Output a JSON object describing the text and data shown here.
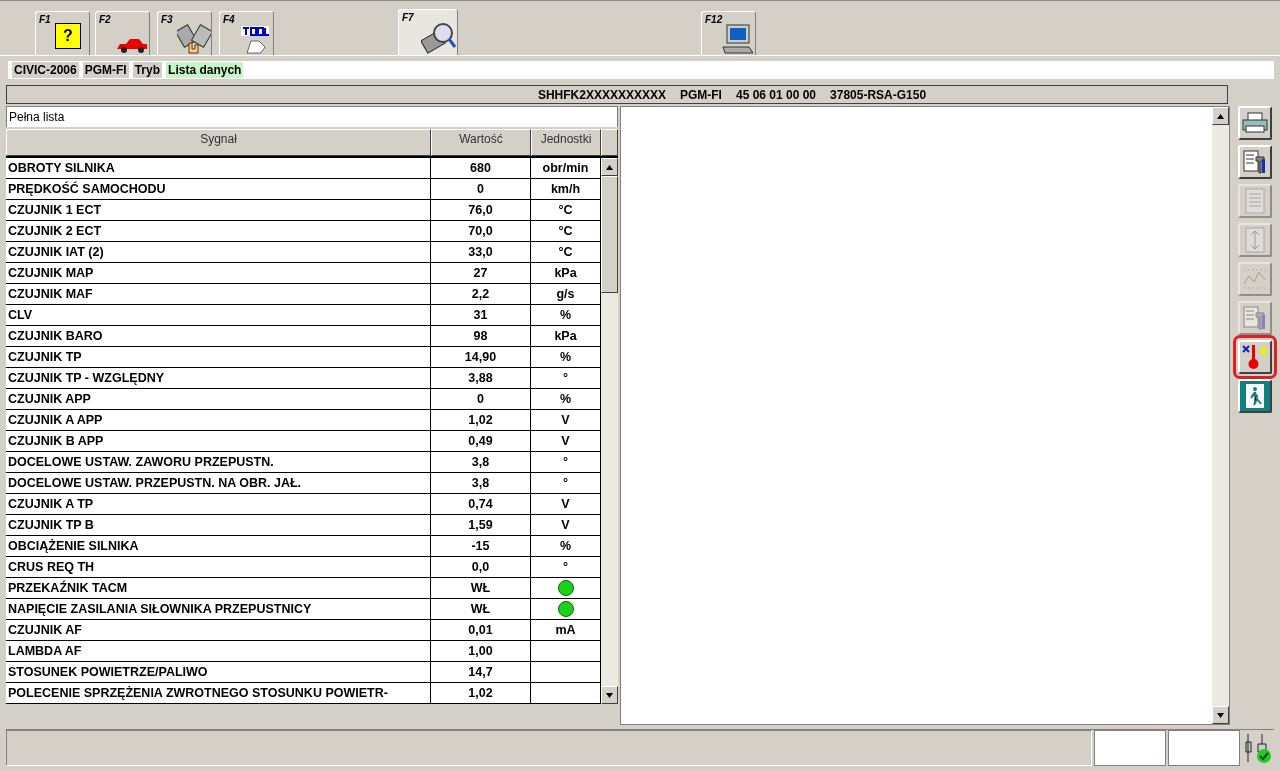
{
  "toolbar": {
    "tabs": [
      {
        "key": "F1",
        "symbol": "?",
        "selected": false
      },
      {
        "key": "F2",
        "selected": false
      },
      {
        "key": "F3",
        "selected": false
      },
      {
        "key": "F4",
        "selected": false
      },
      {
        "key": "F7",
        "selected": true
      },
      {
        "key": "F12",
        "selected": false
      }
    ]
  },
  "breadcrumb": [
    {
      "label": "CIVIC-2006",
      "current": false
    },
    {
      "label": "PGM-FI",
      "current": false
    },
    {
      "label": "Tryb",
      "current": false
    },
    {
      "label": "Lista danych",
      "current": true
    }
  ],
  "header": {
    "vin": "SHHFK2XXXXXXXXXX",
    "system": "PGM-FI",
    "code": "45 06 01 00 00",
    "part": "37805-RSA-G150"
  },
  "list": {
    "title": "Pełna lista",
    "columns": [
      "Sygnał",
      "Wartość",
      "Jednostki"
    ],
    "rows": [
      {
        "signal": "OBROTY SILNIKA",
        "value": "680",
        "kind": "unit",
        "unit": "obr/min"
      },
      {
        "signal": "PRĘDKOŚĆ SAMOCHODU",
        "value": "0",
        "kind": "unit",
        "unit": "km/h"
      },
      {
        "signal": "CZUJNIK 1 ECT",
        "value": "76,0",
        "kind": "unit",
        "unit": "°C"
      },
      {
        "signal": "CZUJNIK 2 ECT",
        "value": "70,0",
        "kind": "unit",
        "unit": "°C"
      },
      {
        "signal": "CZUJNIK IAT (2)",
        "value": "33,0",
        "kind": "unit",
        "unit": "°C"
      },
      {
        "signal": "CZUJNIK MAP",
        "value": "27",
        "kind": "unit",
        "unit": "kPa"
      },
      {
        "signal": "CZUJNIK MAF",
        "value": "2,2",
        "kind": "unit",
        "unit": "g/s"
      },
      {
        "signal": "CLV",
        "value": "31",
        "kind": "unit",
        "unit": "%"
      },
      {
        "signal": "CZUJNIK BARO",
        "value": "98",
        "kind": "unit",
        "unit": "kPa"
      },
      {
        "signal": "CZUJNIK TP",
        "value": "14,90",
        "kind": "unit",
        "unit": "%"
      },
      {
        "signal": "CZUJNIK TP - WZGLĘDNY",
        "value": "3,88",
        "kind": "unit",
        "unit": "°"
      },
      {
        "signal": "CZUJNIK APP",
        "value": "0",
        "kind": "unit",
        "unit": "%"
      },
      {
        "signal": "CZUJNIK A APP",
        "value": "1,02",
        "kind": "unit",
        "unit": "V"
      },
      {
        "signal": "CZUJNIK B APP",
        "value": "0,49",
        "kind": "unit",
        "unit": "V"
      },
      {
        "signal": "DOCELOWE USTAW. ZAWORU PRZEPUSTN.",
        "value": "3,8",
        "kind": "unit",
        "unit": "°"
      },
      {
        "signal": "DOCELOWE USTAW. PRZEPUSTN. NA OBR. JAŁ.",
        "value": "3,8",
        "kind": "unit",
        "unit": "°"
      },
      {
        "signal": "CZUJNIK A TP",
        "value": "0,74",
        "kind": "unit",
        "unit": "V"
      },
      {
        "signal": "CZUJNIK TP B",
        "value": "1,59",
        "kind": "unit",
        "unit": "V"
      },
      {
        "signal": "OBCIĄŻENIE SILNIKA",
        "value": "-15",
        "kind": "unit",
        "unit": "%"
      },
      {
        "signal": "CRUS REQ TH",
        "value": "0,0",
        "kind": "unit",
        "unit": "°"
      },
      {
        "signal": "PRZEKAŹNIK TACM",
        "value": "WŁ",
        "kind": "lamp",
        "color": "#19d219"
      },
      {
        "signal": "NAPIĘCIE ZASILANIA SIŁOWNIKA PRZEPUSTNICY",
        "value": "WŁ",
        "kind": "lamp",
        "color": "#19d219"
      },
      {
        "signal": "CZUJNIK AF",
        "value": "0,01",
        "kind": "unit",
        "unit": "mA"
      },
      {
        "signal": "LAMBDA AF",
        "value": "1,00",
        "kind": "none"
      },
      {
        "signal": "STOSUNEK POWIETRZE/PALIWO",
        "value": "14,7",
        "kind": "none"
      },
      {
        "signal": "POLECENIE SPRZĘŻENIA ZWROTNEGO STOSUNKU POWIETR-",
        "value": "1,02",
        "kind": "none"
      }
    ]
  },
  "side_buttons": [
    {
      "disabled": false,
      "highlighted": false
    },
    {
      "disabled": false,
      "highlighted": false
    },
    {
      "disabled": true,
      "highlighted": false
    },
    {
      "disabled": true,
      "highlighted": false
    },
    {
      "disabled": true,
      "highlighted": false
    },
    {
      "disabled": true,
      "highlighted": false
    },
    {
      "disabled": false,
      "highlighted": true
    },
    {
      "disabled": false,
      "highlighted": false
    }
  ]
}
